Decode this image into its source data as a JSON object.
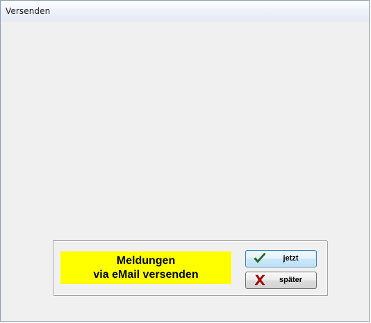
{
  "window": {
    "title": "Versenden"
  },
  "message": {
    "line1": "Meldungen",
    "line2": "via eMail versenden"
  },
  "buttons": {
    "now_label": "jetzt",
    "later_label": "später"
  },
  "colors": {
    "message_background": "#ffff00",
    "check_icon": "#1f7a1f",
    "cross_icon": "#b00000"
  },
  "icons": {
    "now": "checkmark-icon",
    "later": "cross-icon"
  }
}
